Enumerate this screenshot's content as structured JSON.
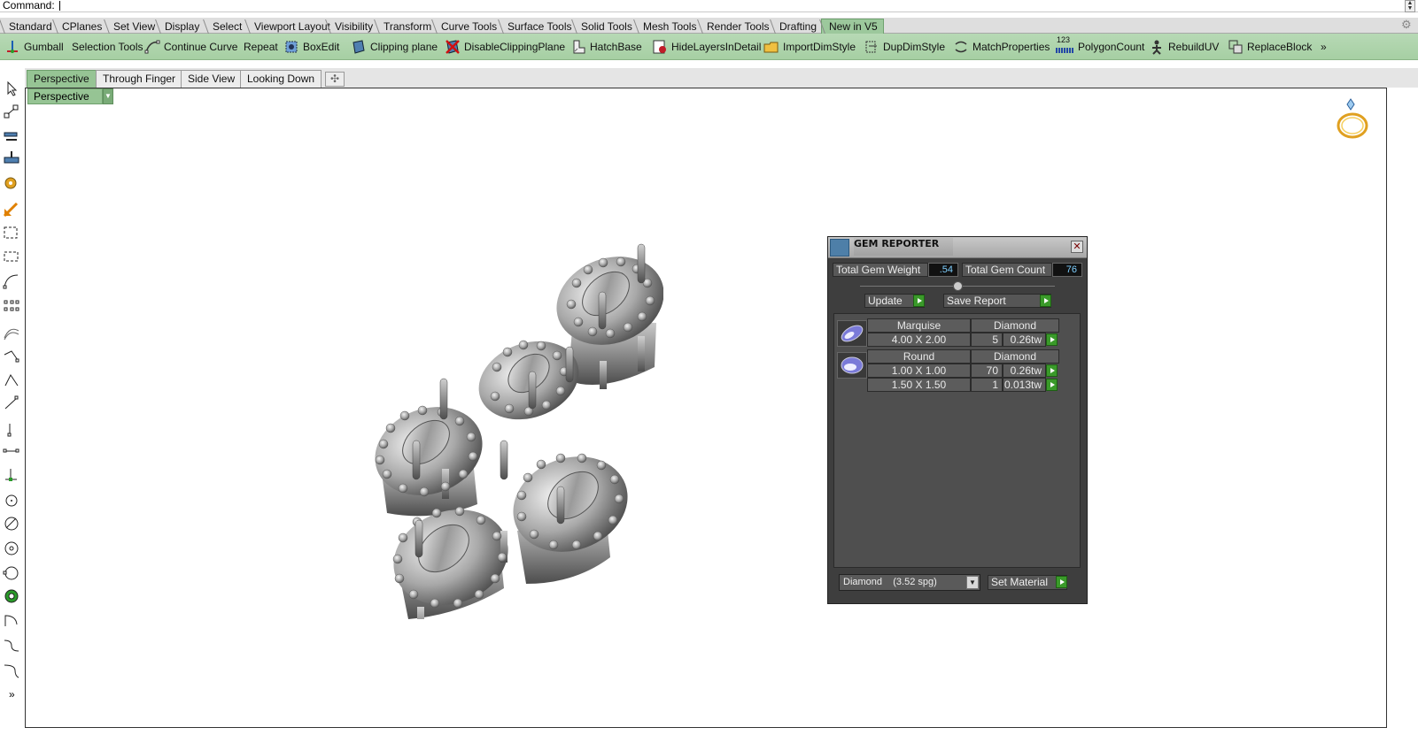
{
  "command": {
    "label": "Command:"
  },
  "toolbar_tabs": [
    "Standard",
    "CPlanes",
    "Set View",
    "Display",
    "Select",
    "Viewport Layout",
    "Visibility",
    "Transform",
    "Curve Tools",
    "Surface Tools",
    "Solid Tools",
    "Mesh Tools",
    "Render Tools",
    "Drafting",
    "New in V5"
  ],
  "active_toolbar_tab": "New in V5",
  "tools": [
    {
      "label": "Gumball",
      "icon": "gumball-icon"
    },
    {
      "label": "Selection Tools",
      "icon": "cursor-icon"
    },
    {
      "label": "Continue Curve",
      "icon": "curve-icon"
    },
    {
      "label": "Repeat",
      "icon": ""
    },
    {
      "label": "BoxEdit",
      "icon": "box-edit-icon"
    },
    {
      "label": "Clipping plane",
      "icon": "clipping-plane-icon"
    },
    {
      "label": "DisableClippingPlane",
      "icon": "disable-clipping-icon"
    },
    {
      "label": "HatchBase",
      "icon": "hatch-icon"
    },
    {
      "label": "HideLayersInDetail",
      "icon": "hide-layers-icon"
    },
    {
      "label": "ImportDimStyle",
      "icon": "import-icon"
    },
    {
      "label": "DupDimStyle",
      "icon": "dup-dim-icon"
    },
    {
      "label": "MatchProperties",
      "icon": "match-properties-icon"
    },
    {
      "label": "PolygonCount",
      "icon": "polygon-count-icon",
      "icon_text": "123"
    },
    {
      "label": "RebuildUV",
      "icon": "rebuild-uv-icon"
    },
    {
      "label": "ReplaceBlock",
      "icon": "replace-block-icon"
    }
  ],
  "toolbar_overflow": "»",
  "left_overflow": "»",
  "viewport_tabs": [
    "Perspective",
    "Through Finger",
    "Side View",
    "Looking Down"
  ],
  "active_viewport_tab": "Perspective",
  "viewport_title": "Perspective",
  "gem_reporter": {
    "title": "GEM REPORTER",
    "total_weight_label": "Total Gem Weight",
    "total_weight_value": ".54",
    "total_count_label": "Total Gem Count",
    "total_count_value": "76",
    "update_label": "Update",
    "save_report_label": "Save Report",
    "groups": [
      {
        "shape": "Marquise",
        "material": "Diamond",
        "rows": [
          {
            "size": "4.00 X 2.00",
            "count": "5",
            "weight": "0.26tw"
          }
        ]
      },
      {
        "shape": "Round",
        "material": "Diamond",
        "rows": [
          {
            "size": "1.00 X 1.00",
            "count": "70",
            "weight": "0.26tw"
          },
          {
            "size": "1.50 X 1.50",
            "count": "1",
            "weight": "0.013tw"
          }
        ]
      }
    ],
    "material_select": "Diamond    (3.52 spg)",
    "set_material_label": "Set Material"
  },
  "colors": {
    "toolbar_green": "#a6cfa3",
    "active_tab_green": "#96c494",
    "panel_dark": "#3e3e3e",
    "go_green": "#3a9a2a",
    "value_blue": "#7fd0ff"
  }
}
